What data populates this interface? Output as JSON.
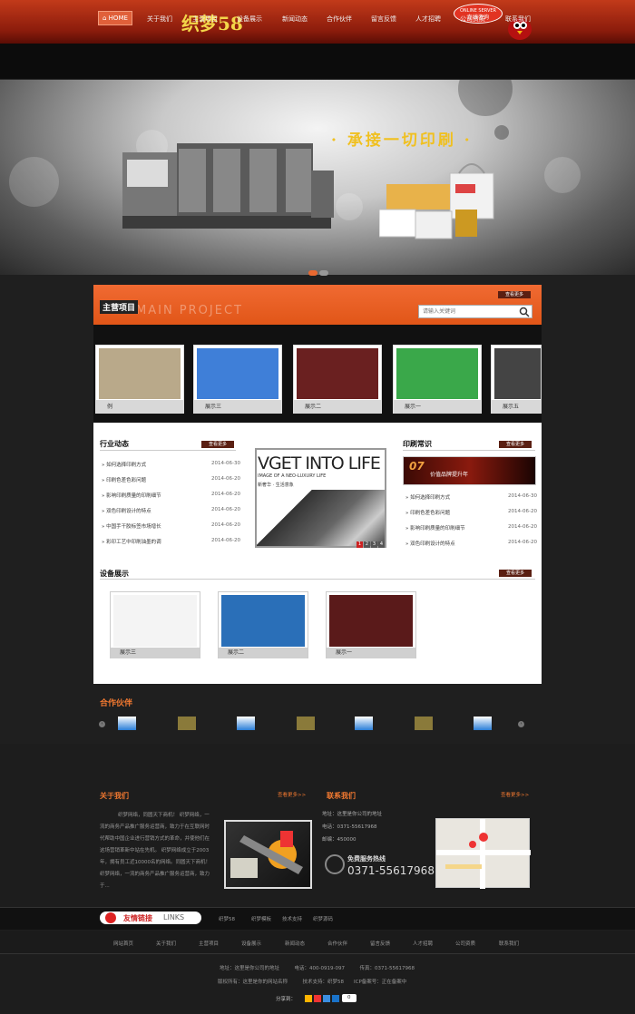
{
  "header": {
    "logo": "织梦58",
    "online_line1": "ONLINE SERVER",
    "online_line2": "在线咨询"
  },
  "nav": {
    "items": [
      "HOME",
      "关于我们",
      "主营项目",
      "设备展示",
      "新闻动态",
      "合作伙伴",
      "留言反馈",
      "人才招聘",
      "公司资质",
      "联系我们"
    ]
  },
  "banner": {
    "title": "· 承接一切印刷 ·"
  },
  "projects": {
    "title": "主营项目",
    "title_en": "MAIN PROJECT",
    "more": "查看更多",
    "search_placeholder": "请输入关键词",
    "carousel": [
      "例",
      "展示三",
      "展示二",
      "展示一",
      "展示五"
    ]
  },
  "industry": {
    "title": "行业动态",
    "more": "查看更多",
    "items": [
      {
        "title": "如何选择印刷方式",
        "date": "2014-06-30"
      },
      {
        "title": "印刷色差色彩问题",
        "date": "2014-06-20"
      },
      {
        "title": "影响印刷质量的印刷细节",
        "date": "2014-06-20"
      },
      {
        "title": "双色印刷设计的特点",
        "date": "2014-06-20"
      },
      {
        "title": "中国手干胶标签市场增长",
        "date": "2014-06-20"
      },
      {
        "title": "彩印工艺中印刷油墨的调",
        "date": "2014-06-20"
      }
    ]
  },
  "magazine": {
    "headline": "VGET INTO LIFE",
    "sub1": "IMAGE OF A NEO-LUXURY LIFE",
    "sub2": "新奢华 · 生活意象",
    "pages": [
      "1",
      "2",
      "3",
      "4"
    ]
  },
  "printing": {
    "title": "印刷常识",
    "more": "查看更多",
    "banner_num": "07",
    "banner_text": "价值品牌提升年",
    "items": [
      {
        "title": "如何选择印刷方式",
        "date": "2014-06-30"
      },
      {
        "title": "印刷色差色彩问题",
        "date": "2014-06-20"
      },
      {
        "title": "影响印刷质量的印刷细节",
        "date": "2014-06-20"
      },
      {
        "title": "双色印刷设计的特点",
        "date": "2014-06-20"
      }
    ]
  },
  "equipment": {
    "title": "设备展示",
    "more": "查看更多",
    "items": [
      "展示三",
      "展示二",
      "展示一"
    ]
  },
  "partners": {
    "title": "合作伙伴"
  },
  "about": {
    "title": "关于我们",
    "more": "查看更多>>",
    "text": "织梦网络，同圆天下商机！ 织梦网络，一流的商务产品推广服务运营商，致力于在互联网时代帮助中国企业进行营销方式的革命，并使他们在这场营销革新中站在先机。 织梦网络成立于2003年，拥有员工近10000名的网络。同圆天下商机！ 织梦网络，一流的商务产品推广服务运营商，致力于..."
  },
  "contact": {
    "title": "联系我们",
    "more": "查看更多>>",
    "address": "地址：这里是你公司的地址",
    "phone": "电话：0371-55617968",
    "zip": "邮编：450000",
    "hotline_label": "免费服务热线",
    "hotline": "0371-55617968"
  },
  "links": {
    "title": "友情链接",
    "title_en": "LINKS",
    "items": [
      "织梦58",
      "织梦模板",
      "技术支持",
      "织梦源码"
    ]
  },
  "footer_nav": [
    "网站首页",
    "关于我们",
    "主营项目",
    "设备展示",
    "新闻动态",
    "合作伙伴",
    "留言反馈",
    "人才招聘",
    "公司资质",
    "联系我们"
  ],
  "footer": {
    "line1": "地址：这里是你公司的地址　　　电话：400-0919-097　　　传真：0371-55617968",
    "line2": "版权所有：这里是你的网站名称　　　技术支持：织梦58　　ICP备案号：正在备案中",
    "share": "分享到：",
    "share_count": "0"
  },
  "colors": {
    "accent": "#f07830",
    "header_red": "#c23a1a"
  }
}
